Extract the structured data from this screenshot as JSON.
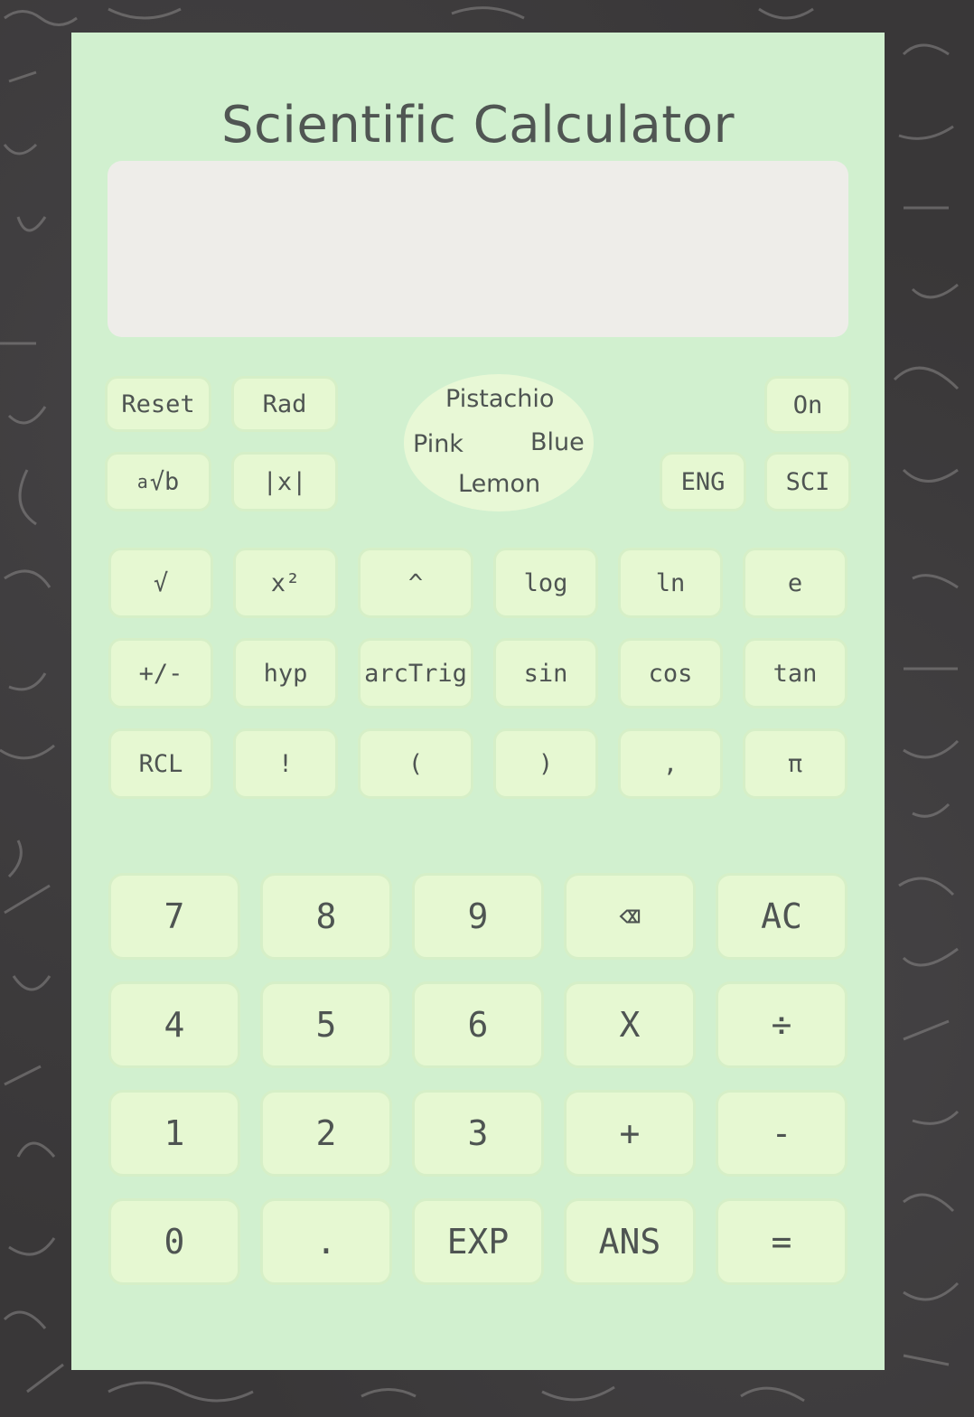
{
  "app": {
    "title": "Scientific Calculator"
  },
  "display": {
    "value": ""
  },
  "controls": {
    "reset": "Reset",
    "rad": "Rad",
    "on": "On",
    "root_a": "a",
    "root_b": "√b",
    "abs": "|x|",
    "eng": "ENG",
    "sci": "SCI"
  },
  "themes": [
    "Pistachio",
    "Pink",
    "Blue",
    "Lemon"
  ],
  "function_keys": [
    [
      "√",
      "x²",
      "^",
      "log",
      "ln",
      "e"
    ],
    [
      "+/-",
      "hyp",
      "arcTrig",
      "sin",
      "cos",
      "tan"
    ],
    [
      "RCL",
      "!",
      "(",
      ")",
      ",",
      "π"
    ]
  ],
  "number_keys": [
    [
      "7",
      "8",
      "9",
      "⌫",
      "AC"
    ],
    [
      "4",
      "5",
      "6",
      "X",
      "÷"
    ],
    [
      "1",
      "2",
      "3",
      "+",
      "-"
    ],
    [
      "0",
      ".",
      "EXP",
      "ANS",
      "="
    ]
  ],
  "colors": {
    "background": "#393738",
    "panel": "#d1f0cf",
    "display": "#eeede9",
    "key": "#e6f8d2",
    "text": "#4e5452"
  }
}
